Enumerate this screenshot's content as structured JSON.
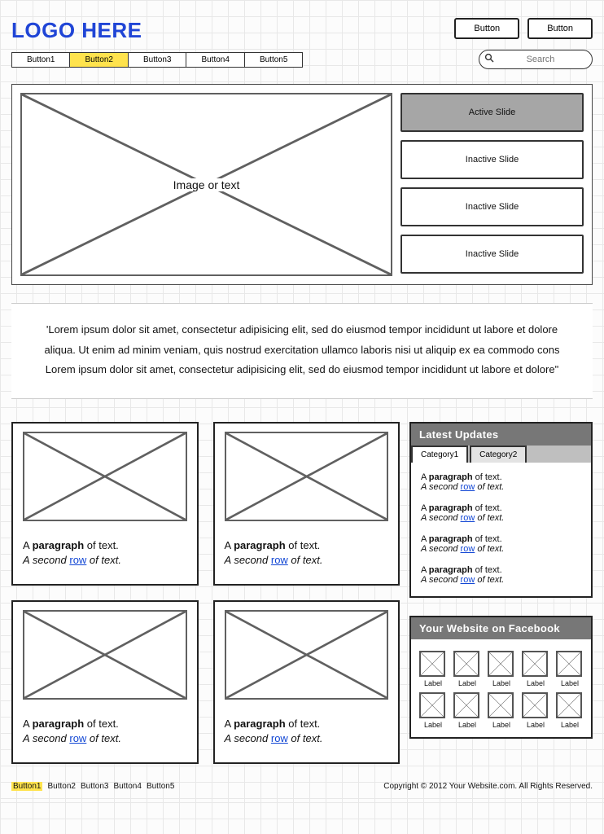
{
  "logo": "LOGO HERE",
  "header_buttons": [
    "Button",
    "Button"
  ],
  "nav": {
    "items": [
      "Button1",
      "Button2",
      "Button3",
      "Button4",
      "Button5"
    ],
    "active_index": 1
  },
  "search": {
    "placeholder": "Search"
  },
  "hero": {
    "image_label": "Image or text",
    "slides": [
      {
        "label": "Active Slide",
        "active": true
      },
      {
        "label": "Inactive Slide",
        "active": false
      },
      {
        "label": "Inactive Slide",
        "active": false
      },
      {
        "label": "Inactive Slide",
        "active": false
      }
    ]
  },
  "intro": {
    "line1": "'Lorem ipsum dolor sit amet, consectetur adipisicing elit, sed do eiusmod tempor incididunt ut labore et dolore",
    "line2": "aliqua. Ut enim ad minim veniam, quis nostrud exercitation ullamco laboris nisi ut aliquip ex ea commodo cons",
    "line3": "Lorem ipsum dolor sit amet, consectetur adipisicing elit, sed do eiusmod tempor incididunt ut labore et dolore\""
  },
  "card_text": {
    "para_prefix": "A ",
    "para_bold": "paragraph",
    "para_suffix": " of text.",
    "second_prefix": "A ",
    "second_italic": "second",
    "second_gap": " ",
    "row_link": "row",
    "second_suffix": " of text."
  },
  "updates": {
    "title": "Latest Updates",
    "tabs": [
      "Category1",
      "Category2"
    ],
    "active_tab": 0,
    "items": 4
  },
  "facebook": {
    "title": "Your Website on Facebook",
    "item_label": "Label",
    "count": 10
  },
  "footer": {
    "links": [
      "Button1",
      "Button2",
      "Button3",
      "Button4",
      "Button5"
    ],
    "active_index": 0,
    "copyright": "Copyright © 2012 Your Website.com. All Rights Reserved."
  }
}
